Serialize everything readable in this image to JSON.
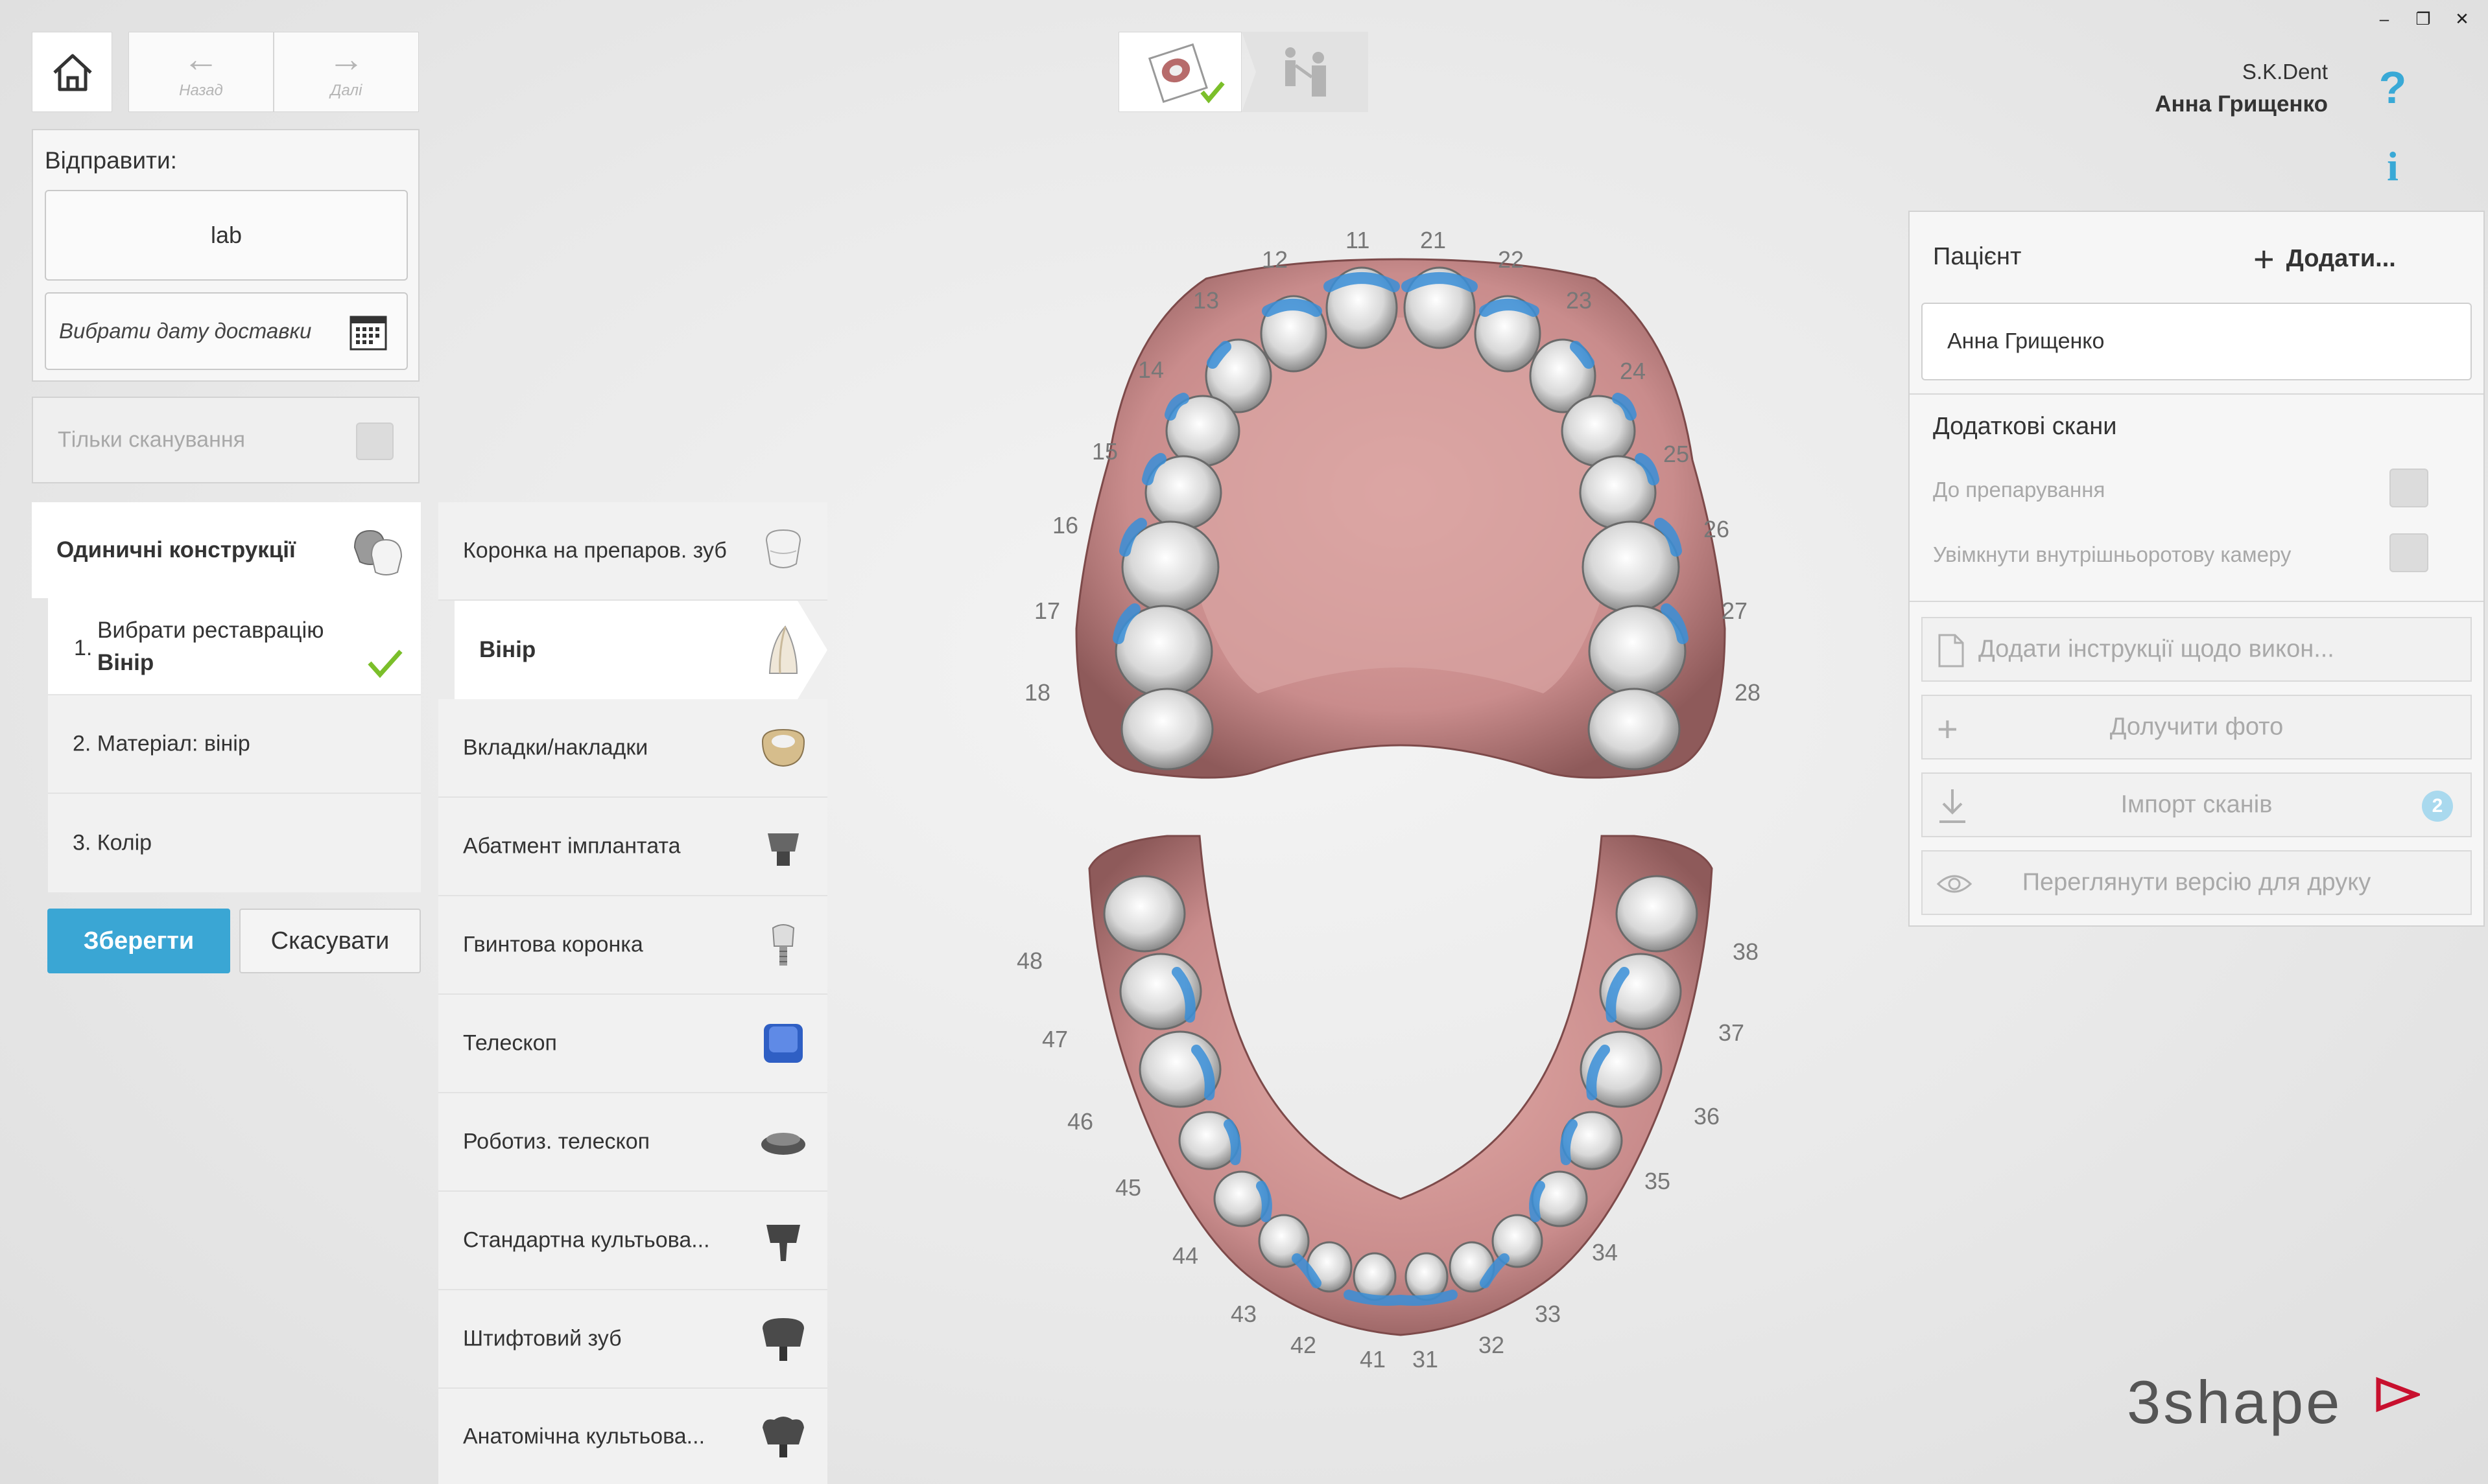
{
  "nav": {
    "back_label": "Назад",
    "forward_label": "Далі"
  },
  "user": {
    "company": "S.K.Dent",
    "name": "Анна Грищенко"
  },
  "help": {
    "question": "?",
    "info": "i"
  },
  "send": {
    "title": "Відправити:",
    "lab_value": "lab",
    "date_placeholder": "Вибрати дату доставки",
    "scan_only_label": "Тільки сканування"
  },
  "workflow": {
    "header": "Одиничні конструкції",
    "steps": [
      {
        "num": "1.",
        "line1": "Вибрати реставрацію",
        "line2": "Вінір"
      },
      {
        "label": "2. Матеріал: вінір"
      },
      {
        "label": "3. Колір"
      }
    ],
    "save_label": "Зберегти",
    "cancel_label": "Скасувати"
  },
  "restorations": [
    {
      "label": "Коронка на препаров. зуб",
      "icon": "crown-icon"
    },
    {
      "label": "Вінір",
      "icon": "veneer-icon",
      "selected": true
    },
    {
      "label": "Вкладки/накладки",
      "icon": "inlay-icon"
    },
    {
      "label": "Абатмент імплантата",
      "icon": "abutment-icon"
    },
    {
      "label": "Гвинтова коронка",
      "icon": "screw-crown-icon"
    },
    {
      "label": "Телескоп",
      "icon": "telescope-icon"
    },
    {
      "label": "Роботиз. телескоп",
      "icon": "robot-telescope-icon"
    },
    {
      "label": "Стандартна культьова...",
      "icon": "post-core-icon"
    },
    {
      "label": "Штифтовий зуб",
      "icon": "pin-tooth-icon"
    },
    {
      "label": "Анатомічна культьова...",
      "icon": "anatomic-core-icon"
    }
  ],
  "tooth_numbers": {
    "upper": [
      "11",
      "21",
      "12",
      "22",
      "13",
      "23",
      "14",
      "24",
      "15",
      "25",
      "16",
      "26",
      "17",
      "27",
      "18",
      "28"
    ],
    "lower": [
      "48",
      "38",
      "47",
      "37",
      "46",
      "36",
      "45",
      "35",
      "44",
      "34",
      "43",
      "33",
      "42",
      "32",
      "41",
      "31"
    ]
  },
  "patient": {
    "title": "Пацієнт",
    "add_label": "Додати...",
    "name_value": "Анна Грищенко",
    "extra_scans_title": "Додаткові скани",
    "pre_prep_label": "До препарування",
    "intraoral_label": "Увімкнути внутрішньоротову камеру",
    "instructions_label": "Додати інструкції щодо викон...",
    "attach_photo_label": "Долучити фото",
    "import_scans_label": "Імпорт сканів",
    "import_badge": "2",
    "print_preview_label": "Переглянути версію для друку"
  },
  "brand": {
    "logo_text": "3shape"
  },
  "colors": {
    "accent": "#39a9d6",
    "check": "#7bbf2a",
    "gum": "#c98c8c",
    "tooth_blue": "#3a8fd8"
  }
}
